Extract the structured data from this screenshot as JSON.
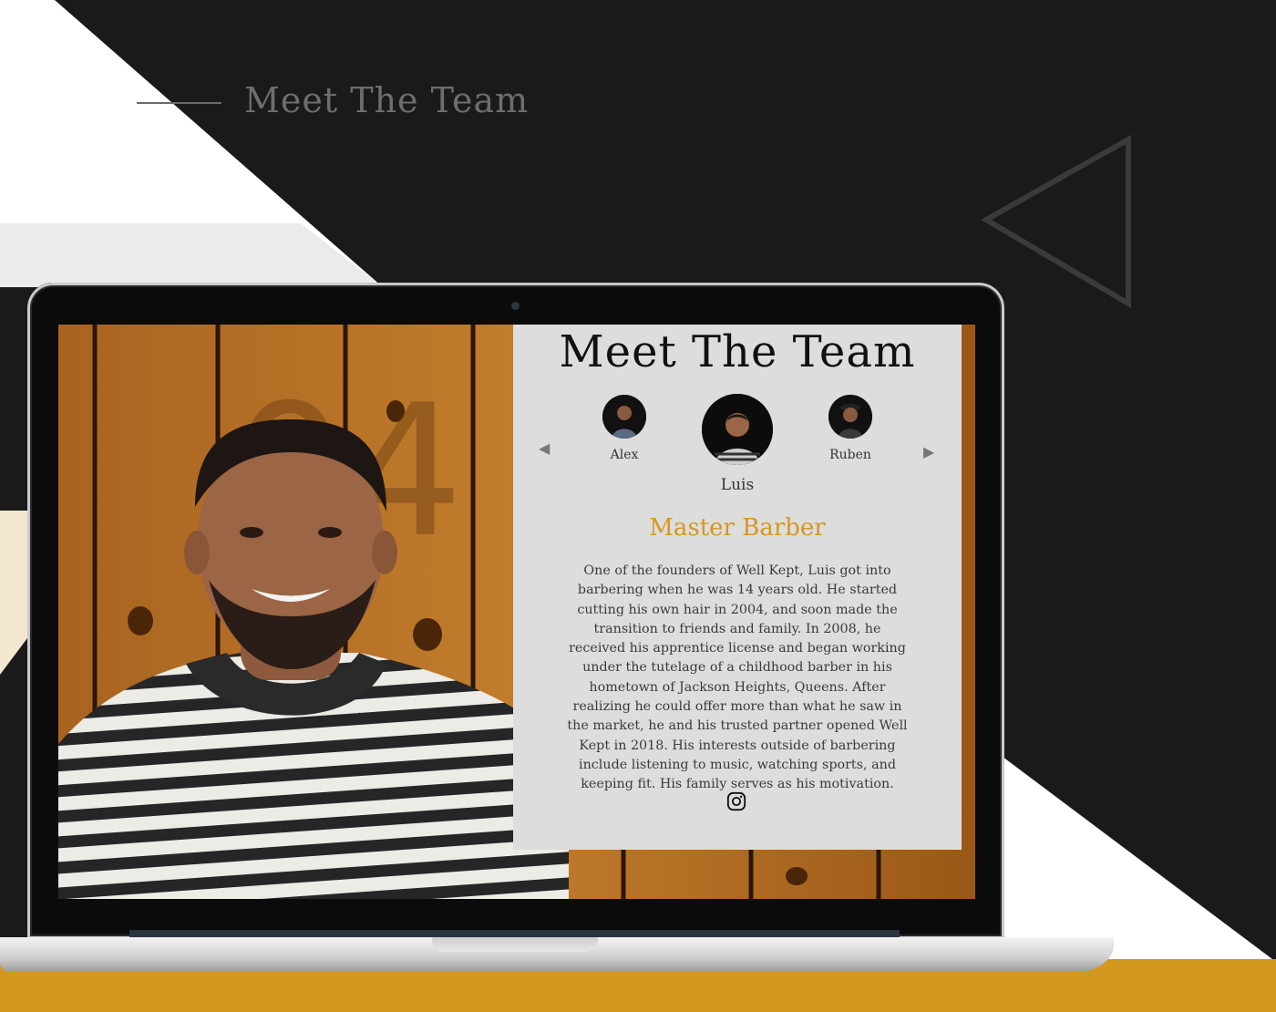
{
  "page": {
    "header_title": "Meet The Team",
    "colors": {
      "accent": "#d4981e",
      "dark_bg": "#1a1a1a",
      "panel_bg": "#dddddd"
    }
  },
  "site": {
    "title": "Meet The Team",
    "nav": {
      "prev_icon": "triangle-left-icon",
      "next_icon": "triangle-right-icon"
    },
    "members": [
      {
        "name": "Alex"
      },
      {
        "name": "Luis"
      },
      {
        "name": "Ruben"
      }
    ],
    "role": "Master Barber",
    "bio": "One of the founders of Well Kept, Luis got into barbering when he was 14 years old. He started cutting his own hair in 2004, and soon made the transition to friends and family. In 2008, he received his apprentice license and began working under the tutelage of a childhood barber in his hometown of Jackson Heights, Queens. After realizing he could offer more than what he saw in the market, he and his trusted partner opened Well Kept in 2018. His interests outside of barbering include listening to music, watching sports, and keeping fit. His family serves as his motivation.",
    "social_icon": "instagram-icon"
  }
}
